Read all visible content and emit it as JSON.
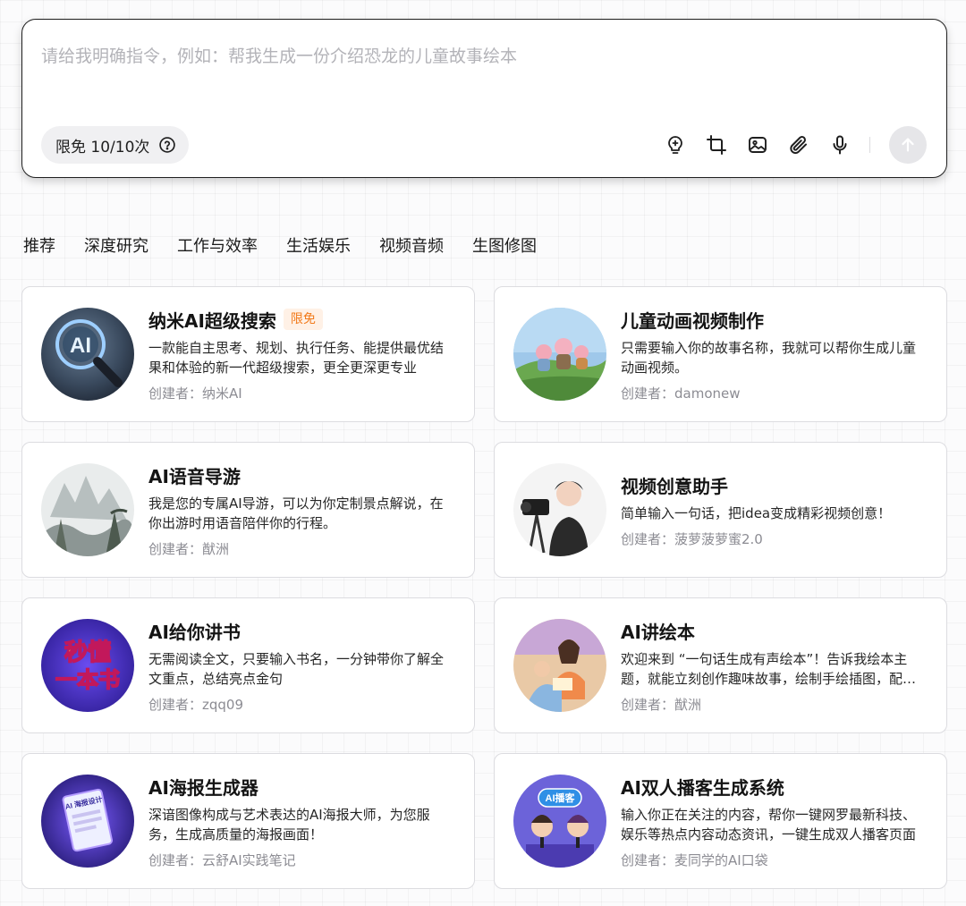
{
  "prompt": {
    "placeholder": "请给我明确指令，例如：帮我生成一份介绍恐龙的儿童故事绘本",
    "quota_label": "限免 10/10次"
  },
  "toolbar": {
    "icons": [
      "sparkle-bulb-icon",
      "crop-icon",
      "image-icon",
      "paperclip-icon",
      "microphone-icon",
      "arrow-up-icon"
    ]
  },
  "tabs": [
    "推荐",
    "深度研究",
    "工作与效率",
    "生活娱乐",
    "视频音频",
    "生图修图"
  ],
  "cards": [
    {
      "title": "纳米AI超级搜索",
      "badge": "限免",
      "desc": "一款能自主思考、规划、执行任务、能提供最优结果和体验的新一代超级搜索，更全更深更专业",
      "author": "创建者：纳米AI"
    },
    {
      "title": "儿童动画视频制作",
      "badge": "",
      "desc": "只需要输入你的故事名称，我就可以帮你生成儿童动画视频。",
      "author": "创建者：damonew"
    },
    {
      "title": "AI语音导游",
      "badge": "",
      "desc": "我是您的专属AI导游，可以为你定制景点解说，在你出游时用语音陪伴你的行程。",
      "author": "创建者：猷洲"
    },
    {
      "title": "视频创意助手",
      "badge": "",
      "desc": "简单输入一句话，把idea变成精彩视频创意！",
      "author": "创建者：菠萝菠萝蜜2.0"
    },
    {
      "title": "AI给你讲书",
      "badge": "",
      "desc": "无需阅读全文，只要输入书名，一分钟带你了解全文重点，总结亮点金句",
      "author": "创建者：zqq09"
    },
    {
      "title": "AI讲绘本",
      "badge": "",
      "desc": "欢迎来到 “一句话生成有声绘本”！告诉我绘本主题，就能立刻创作趣味故事，绘制手绘插图，配上生动的语音朗读",
      "author": "创建者：猷洲"
    },
    {
      "title": "AI海报生成器",
      "badge": "",
      "desc": "深谙图像构成与艺术表达的AI海报大师，为您服务，生成高质量的海报画面！",
      "author": "创建者：云舒AI实践笔记"
    },
    {
      "title": "AI双人播客生成系统",
      "badge": "",
      "desc": "输入你正在关注的内容，帮你一键网罗最新科技、娱乐等热点内容动态资讯，一键生成双人播客页面",
      "author": "创建者：麦同学的AI口袋"
    }
  ],
  "avatar_text": {
    "search": "AI",
    "book_line1": "秒懂",
    "book_line2": "一本书",
    "poster": "AI 海报设计",
    "podcast": "AI播客"
  }
}
